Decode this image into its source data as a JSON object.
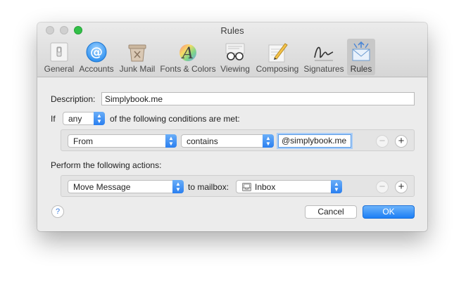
{
  "window": {
    "title": "Rules"
  },
  "toolbar": {
    "items": [
      {
        "label": "General",
        "icon": "general-switch-icon"
      },
      {
        "label": "Accounts",
        "icon": "at-sign-icon"
      },
      {
        "label": "Junk Mail",
        "icon": "junk-bin-icon"
      },
      {
        "label": "Fonts & Colors",
        "icon": "fonts-colors-icon"
      },
      {
        "label": "Viewing",
        "icon": "glasses-icon"
      },
      {
        "label": "Composing",
        "icon": "pencil-paper-icon"
      },
      {
        "label": "Signatures",
        "icon": "signature-icon"
      },
      {
        "label": "Rules",
        "icon": "rules-envelope-icon"
      }
    ],
    "selected": "Rules"
  },
  "form": {
    "description_label": "Description:",
    "description_value": "Simplybook.me",
    "if_label": "If",
    "match_value": "any",
    "conditions_label": "of the following conditions are met:",
    "condition": {
      "field": "From",
      "operator": "contains",
      "value": "@simplybook.me"
    },
    "actions_label": "Perform the following actions:",
    "action": {
      "type": "Move Message",
      "to_label": "to mailbox:",
      "mailbox": "Inbox"
    },
    "help_label": "?",
    "cancel_label": "Cancel",
    "ok_label": "OK"
  },
  "colors": {
    "accent": "#2a7ff0",
    "zoom_button": "#32c048"
  }
}
